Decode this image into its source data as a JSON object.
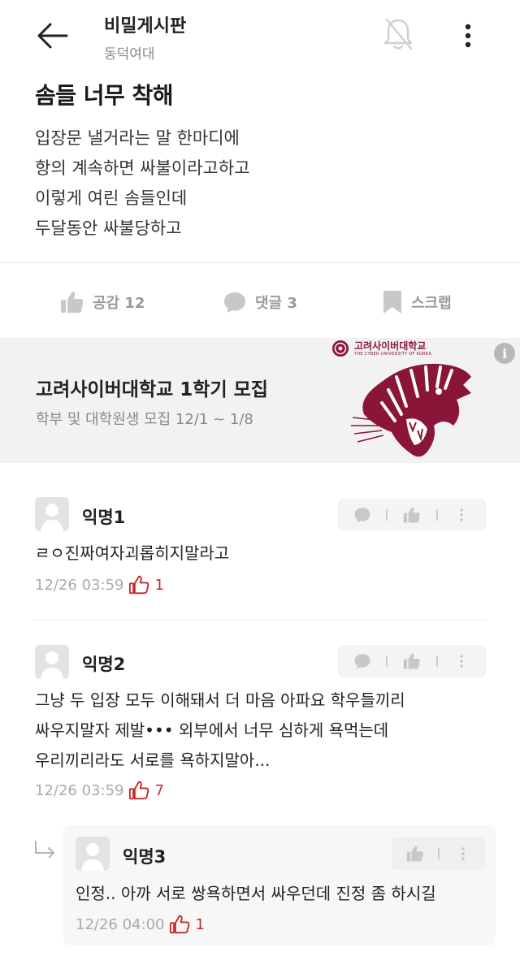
{
  "header": {
    "title": "비밀게시판",
    "subtitle": "동덕여대"
  },
  "post": {
    "title": "솜들 너무 착해",
    "body_lines": [
      "입장문 낼거라는 말 한마디에",
      "항의 계속하면 싸불이라고하고",
      "이렇게 여린 솜들인데",
      "두달동안 싸불당하고"
    ]
  },
  "actions": {
    "like": "공감 12",
    "comment": "댓글 3",
    "scrap": "스크랩"
  },
  "ad": {
    "title": "고려사이버대학교 1학기 모집",
    "subtitle": "학부 및 대학원생 모집 12/1 ~ 1/8",
    "logo_text": "고려사이버대학교",
    "logo_sub": "THE CYBER UNIVERSITY OF KOREA",
    "info": "i"
  },
  "comments": [
    {
      "author": "익명1",
      "lines": [
        "ㄹㅇ진짜여자괴롭히지말라고"
      ],
      "time": "12/26 03:59",
      "votes": "1"
    },
    {
      "author": "익명2",
      "lines": [
        "그냥 두 입장 모두 이해돼서 더 마음 아파요 학우들끼리",
        "싸우지말자 제발••• 외부에서 너무 심하게 욕먹는데",
        "우리끼리라도 서로를 욕하지말아..."
      ],
      "time": "12/26 03:59",
      "votes": "7"
    },
    {
      "author": "익명3",
      "lines": [
        "인정.. 아까 서로 쌍욕하면서 싸우던데 진정 좀 하시길"
      ],
      "time": "12/26 04:00",
      "votes": "1"
    }
  ],
  "colors": {
    "accent_red": "#c62828",
    "ad_brand": "#8a1538"
  }
}
